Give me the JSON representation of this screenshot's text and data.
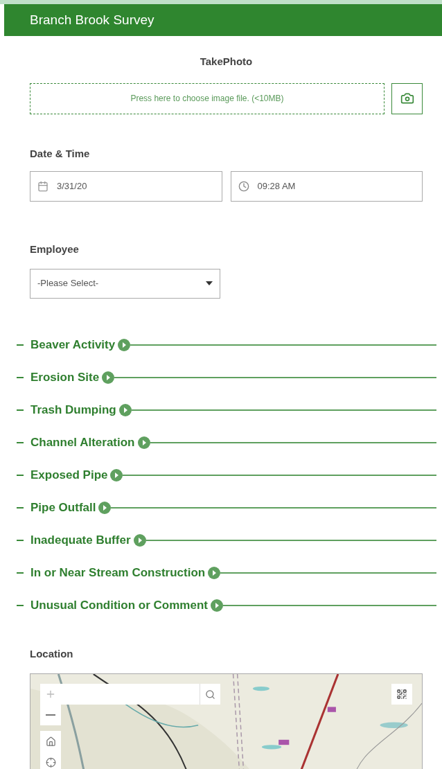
{
  "header": {
    "title": "Branch Brook Survey"
  },
  "photo": {
    "label": "TakePhoto",
    "dropzone": "Press here to choose image file. (<10MB)"
  },
  "datetime": {
    "label": "Date & Time",
    "date": "3/31/20",
    "time": "09:28 AM"
  },
  "employee": {
    "label": "Employee",
    "value": "-Please Select-"
  },
  "groups": [
    {
      "title": "Beaver Activity"
    },
    {
      "title": "Erosion Site"
    },
    {
      "title": "Trash Dumping"
    },
    {
      "title": "Channel Alteration"
    },
    {
      "title": "Exposed Pipe"
    },
    {
      "title": "Pipe Outfall"
    },
    {
      "title": "Inadequate Buffer"
    },
    {
      "title": "In or Near Stream Construction"
    },
    {
      "title": "Unusual Condition or Comment"
    }
  ],
  "location": {
    "label": "Location"
  }
}
